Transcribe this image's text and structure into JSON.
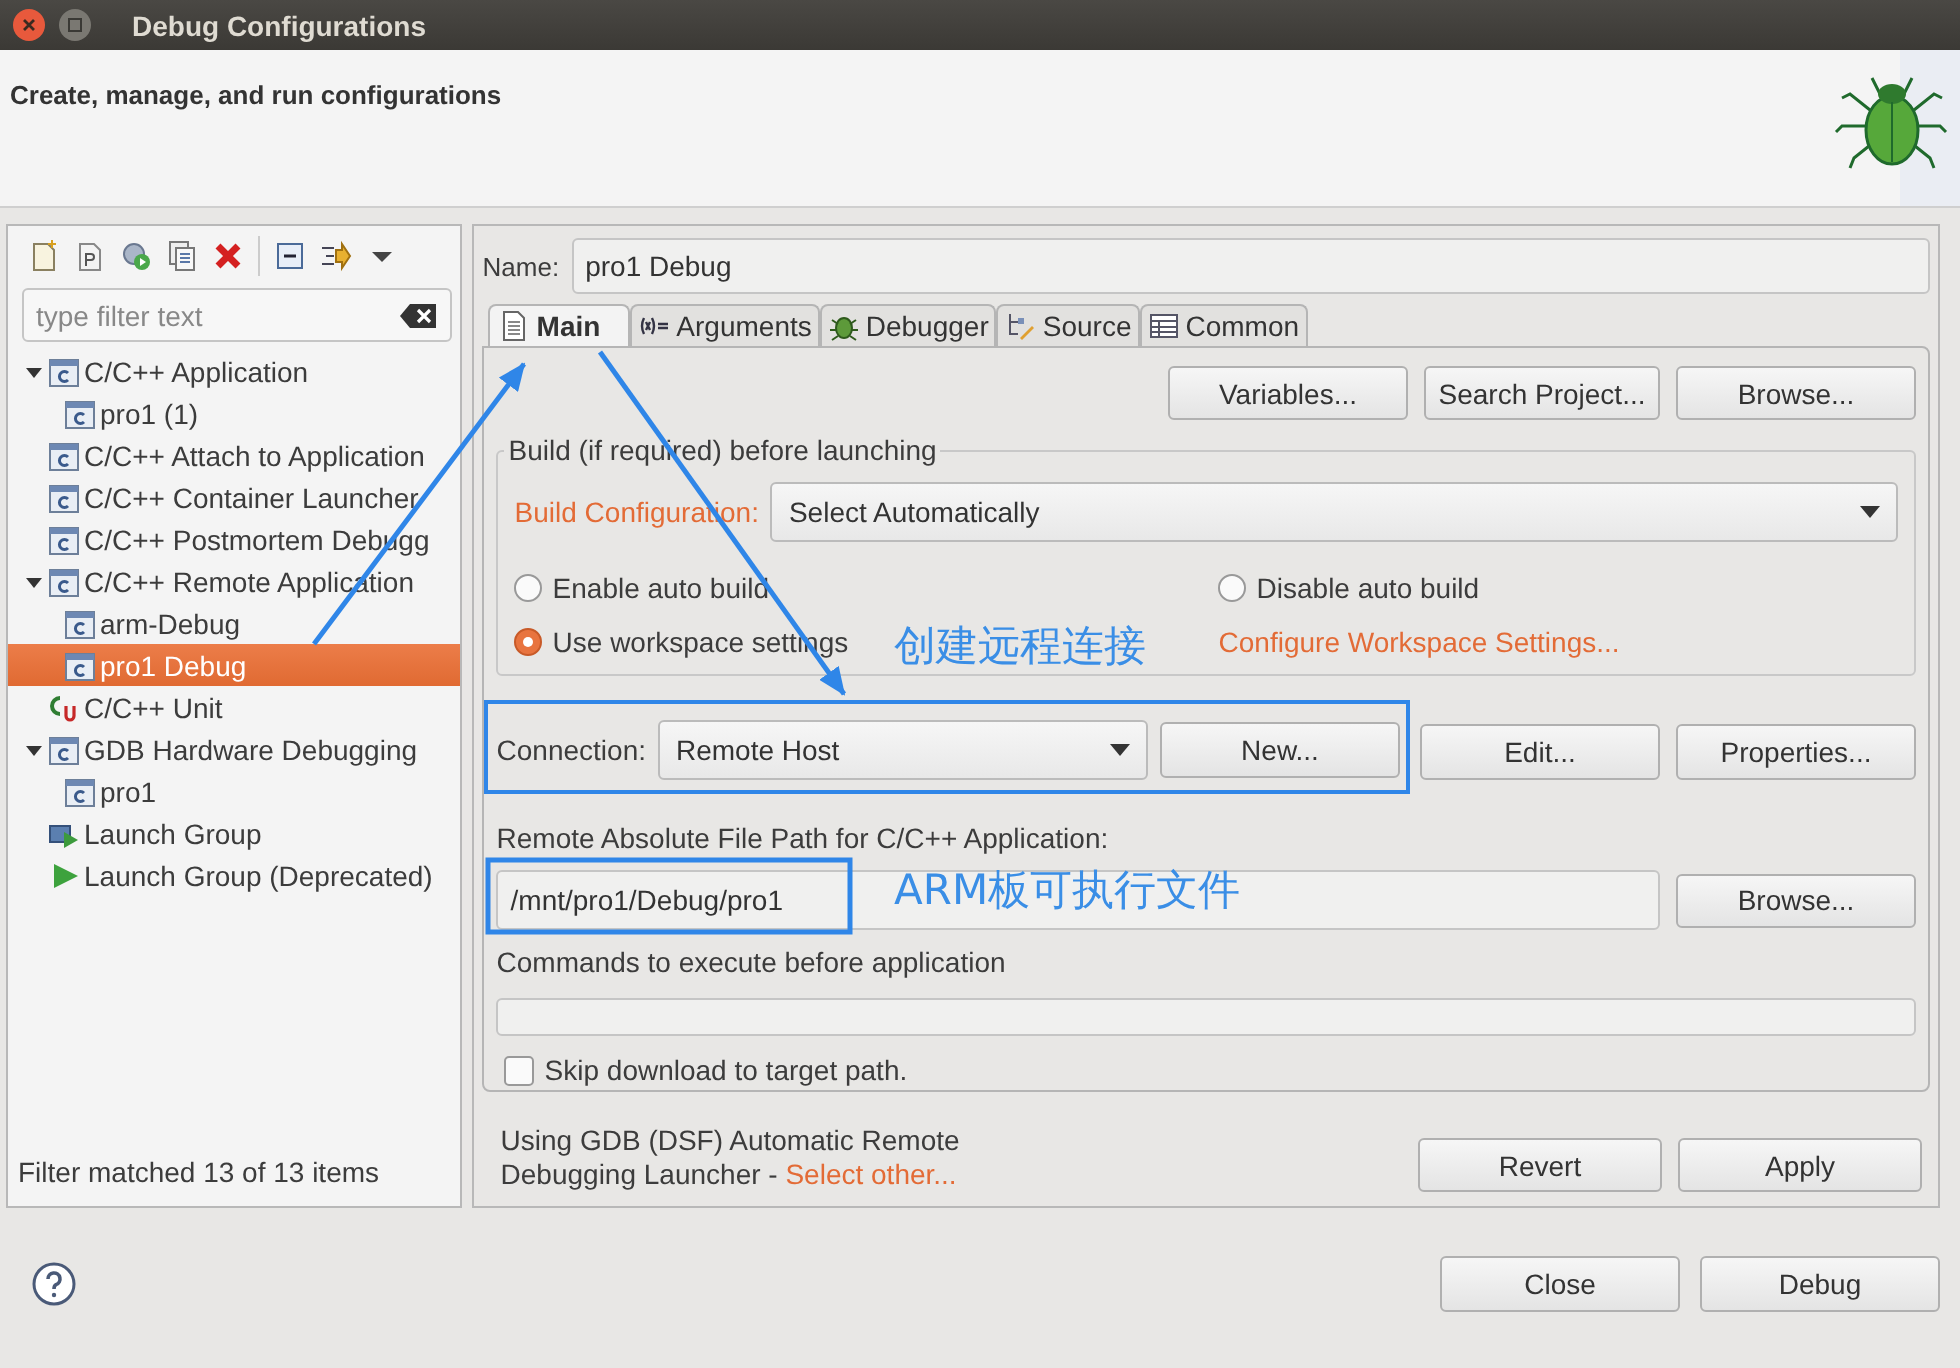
{
  "window": {
    "title": "Debug Configurations"
  },
  "header": {
    "subtitle": "Create, manage, and run configurations"
  },
  "sidebar": {
    "filter": {
      "placeholder": "type filter text"
    },
    "tree": [
      {
        "label": "C/C++ Application",
        "kind": "config",
        "expanded": true,
        "selected": false,
        "children": [
          {
            "label": "pro1 (1)",
            "kind": "config",
            "selected": false
          }
        ]
      },
      {
        "label": "C/C++ Attach to Application",
        "kind": "config",
        "selected": false
      },
      {
        "label": "C/C++ Container Launcher",
        "kind": "config",
        "selected": false
      },
      {
        "label": "C/C++ Postmortem Debugg",
        "kind": "config",
        "selected": false
      },
      {
        "label": "C/C++ Remote Application",
        "kind": "config",
        "expanded": true,
        "selected": false,
        "children": [
          {
            "label": "arm-Debug",
            "kind": "config",
            "selected": false
          },
          {
            "label": "pro1 Debug",
            "kind": "config",
            "selected": true
          }
        ]
      },
      {
        "label": "C/C++ Unit",
        "kind": "unit",
        "selected": false
      },
      {
        "label": "GDB Hardware Debugging",
        "kind": "config",
        "expanded": true,
        "selected": false,
        "children": [
          {
            "label": "pro1",
            "kind": "config",
            "selected": false
          }
        ]
      },
      {
        "label": "Launch Group",
        "kind": "group",
        "selected": false
      },
      {
        "label": "Launch Group (Deprecated)",
        "kind": "deprecated",
        "selected": false
      }
    ],
    "status": "Filter matched 13 of 13 items"
  },
  "editor": {
    "name_label": "Name:",
    "name_value": "pro1 Debug",
    "tabs": [
      {
        "label": "Main",
        "kind": "main",
        "selected": true
      },
      {
        "label": "Arguments",
        "kind": "arguments",
        "selected": false
      },
      {
        "label": "Debugger",
        "kind": "debugger",
        "selected": false
      },
      {
        "label": "Source",
        "kind": "source",
        "selected": false
      },
      {
        "label": "Common",
        "kind": "common",
        "selected": false
      }
    ],
    "top_buttons": [
      "Variables...",
      "Search Project...",
      "Browse..."
    ],
    "build_group": {
      "title": "Build (if required) before launching",
      "config_label": "Build Configuration:",
      "config_value": "Select Automatically",
      "options": [
        {
          "label": "Enable auto build",
          "selected": false
        },
        {
          "label": "Disable auto build",
          "selected": false
        },
        {
          "label": "Use workspace settings",
          "selected": true
        }
      ],
      "link": "Configure Workspace Settings..."
    },
    "connection": {
      "label": "Connection:",
      "value": "Remote Host",
      "buttons": [
        "New...",
        "Edit...",
        "Properties..."
      ]
    },
    "remote_path": {
      "label": "Remote Absolute File Path for C/C++ Application:",
      "value": "/mnt/pro1/Debug/pro1",
      "button": "Browse..."
    },
    "commands": {
      "label": "Commands to execute before application"
    },
    "skip_download": {
      "label": "Skip download to target path.",
      "checked": false
    },
    "launcher": {
      "text": "Using GDB (DSF) Automatic Remote Debugging Launcher - ",
      "link": "Select other..."
    },
    "actions": [
      "Revert",
      "Apply"
    ]
  },
  "dialog_buttons": [
    "Close",
    "Debug"
  ],
  "annotations": [
    {
      "text": "创建远程连接"
    },
    {
      "text": "ARM板可执行文件"
    }
  ]
}
